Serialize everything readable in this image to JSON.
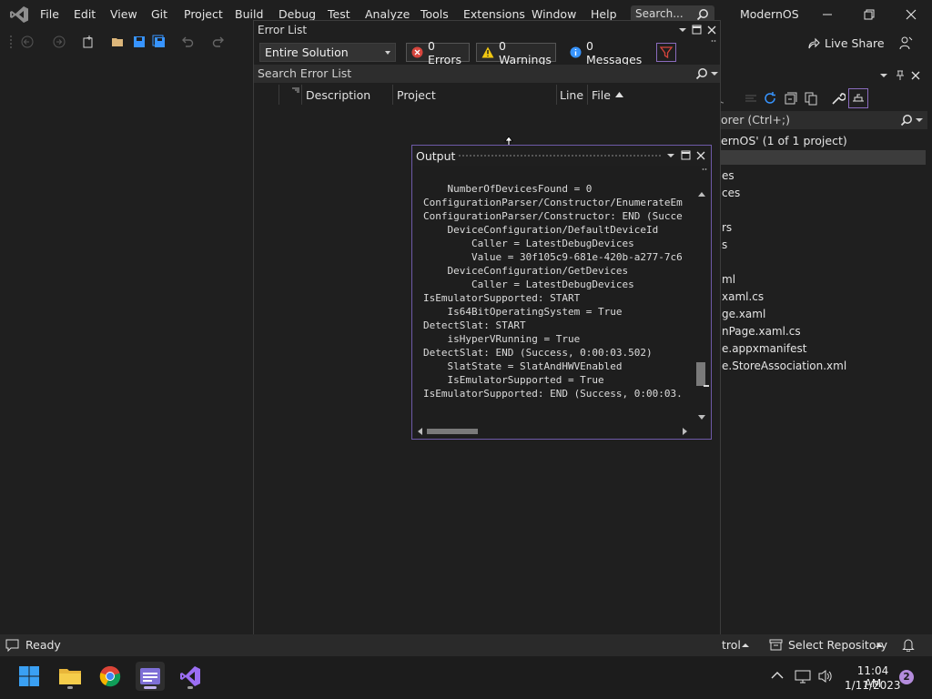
{
  "menu": {
    "items": [
      "File",
      "Edit",
      "View",
      "Git",
      "Project",
      "Build",
      "Debug",
      "Test",
      "Analyze",
      "Tools",
      "Extensions",
      "Window",
      "Help"
    ],
    "search_placeholder": "Search...",
    "solution_name": "ModernOS"
  },
  "toolbar": {
    "live_share_label": "Live Share"
  },
  "error_list": {
    "title": "Error List",
    "scope": "Entire Solution",
    "errors_label": "0 Errors",
    "warnings_label": "0 Warnings",
    "messages_label": "0 Messages",
    "search_placeholder": "Search Error List",
    "columns": [
      "Description",
      "Project",
      "Line",
      "File"
    ]
  },
  "solution_explorer": {
    "search_placeholder": "orer (Ctrl+;)",
    "summary": "ernOS' (1 of 1 project)",
    "items": [
      "es",
      "ces",
      "rs",
      "s",
      "ml",
      "xaml.cs",
      "ge.xaml",
      "nPage.xaml.cs",
      "e.appxmanifest",
      "e.StoreAssociation.xml"
    ]
  },
  "output": {
    "title": "Output",
    "lines": [
      "    NumberOfDevicesFound = 0",
      "ConfigurationParser/Constructor/EnumerateEm",
      "ConfigurationParser/Constructor: END (Succe",
      "    DeviceConfiguration/DefaultDeviceId",
      "        Caller = LatestDebugDevices",
      "        Value = 30f105c9-681e-420b-a277-7c6",
      "    DeviceConfiguration/GetDevices",
      "        Caller = LatestDebugDevices",
      "IsEmulatorSupported: START",
      "    Is64BitOperatingSystem = True",
      "DetectSlat: START",
      "    isHyperVRunning = True",
      "DetectSlat: END (Success, 0:00:03.502)",
      "    SlatState = SlatAndHWVEnabled",
      "    IsEmulatorSupported = True",
      "IsEmulatorSupported: END (Success, 0:00:03."
    ]
  },
  "status": {
    "ready": "Ready",
    "source_control": "trol",
    "select_repository": "Select Repository"
  },
  "taskbar": {
    "time": "11:04 AM",
    "date": "1/11/2023",
    "notification_count": "2"
  },
  "colors": {
    "accent": "#8a6bbd",
    "background": "#1f1f1f",
    "error_red": "#d6453d",
    "warning_yellow": "#f2c811",
    "info_blue": "#3794ff"
  }
}
